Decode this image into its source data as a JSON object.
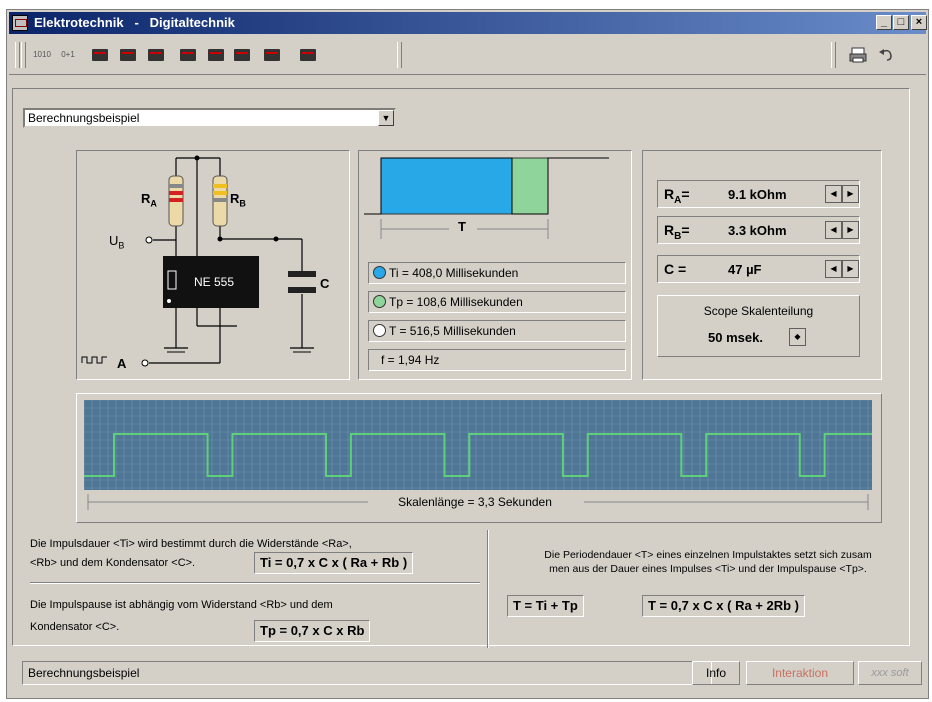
{
  "window": {
    "title_app": "Elektrotechnik",
    "title_sep": "-",
    "title_section": "Digitaltechnik",
    "controls": {
      "minimize": "_",
      "maximize": "□",
      "close": "×"
    }
  },
  "toolbar": {
    "left_tools": [
      {
        "icon": "counter-1010-icon",
        "label": "1010"
      },
      {
        "icon": "counter-0plus1-icon",
        "label": "0+1"
      },
      {
        "icon": "component-icon",
        "label": ""
      },
      {
        "icon": "chip-icon",
        "label": ""
      },
      {
        "icon": "chip-gray-icon",
        "label": ""
      },
      {
        "icon": "ic-1-icon",
        "label": ""
      },
      {
        "icon": "ic-2-icon",
        "label": ""
      },
      {
        "icon": "ic-3-icon",
        "label": ""
      },
      {
        "icon": "converter-icon",
        "label": ""
      },
      {
        "icon": "chip-stack-icon",
        "label": ""
      }
    ],
    "right_tools": [
      {
        "icon": "print-icon"
      },
      {
        "icon": "undo-icon"
      }
    ]
  },
  "selector": {
    "value": "Berechnungsbeispiel"
  },
  "circuit": {
    "ic_label": "NE 555",
    "ra_label": "R",
    "ra_sub": "A",
    "rb_label": "R",
    "rb_sub": "B",
    "ub_label": "U",
    "ub_sub": "B",
    "c_label": "C",
    "a_label": "A"
  },
  "pulse_panel": {
    "t_label": "T",
    "lines": [
      {
        "dot": "#29a8e8",
        "text": "Ti  = 408,0 Millisekunden"
      },
      {
        "dot": "#8fd49a",
        "text": "Tp  = 108,6 Millisekunden"
      },
      {
        "dot": "#ffffff",
        "text": "T    = 516,5 Millisekunden"
      },
      {
        "dot": "",
        "text": "f    = 1,94 Hz"
      }
    ]
  },
  "values_panel": {
    "ra": {
      "label": "R",
      "sub": "A",
      "eq": "=",
      "value": "9.1 kOhm"
    },
    "rb": {
      "label": "R",
      "sub": "B",
      "eq": "=",
      "value": "3.3 kOhm"
    },
    "c": {
      "label": "C",
      "eq": "=",
      "value": "47 µF"
    },
    "scope_title": "Scope Skalenteilung",
    "scope_value": "50 msek."
  },
  "scope": {
    "caption": "Skalenlänge = 3,3 Sekunden",
    "pulse_high_fraction": 0.79,
    "period_count": 6.4
  },
  "explanations": {
    "ti_text_1": "Die Impulsdauer <Ti> wird bestimmt durch die Widerstände <Ra>,",
    "ti_text_2": "<Rb> und dem Kondensator <C>.",
    "ti_formula": "Ti = 0,7 x C x ( Ra + Rb )",
    "tp_text_1": "Die Impulspause ist abhängig vom Widerstand <Rb> und dem",
    "tp_text_2": "Kondensator <C>.",
    "tp_formula": "Tp = 0,7 x C x Rb",
    "t_text_1": "Die Periodendauer <T> eines einzelnen Impulstaktes setzt sich zusam",
    "t_text_2": "men aus der Dauer eines Impulses <Ti> und der Impulspause <Tp>.",
    "t_formula_1": "T = Ti + Tp",
    "t_formula_2": "T = 0,7 x C x ( Ra + 2Rb )"
  },
  "statusbar": {
    "text": "Berechnungsbeispiel",
    "info": "Info",
    "interaktion": "Interaktion",
    "brand": "xxx soft"
  },
  "colors": {
    "pulse_high": "#29a8e8",
    "pulse_low": "#8fd49a",
    "scope_bg": "#4f7694",
    "scope_grid": "#6f96b4",
    "scope_trace": "#5fd07a",
    "resistor_body": "#ecd9a8",
    "resistor_band_red": "#d42020",
    "resistor_band_yellow": "#f0c020"
  }
}
